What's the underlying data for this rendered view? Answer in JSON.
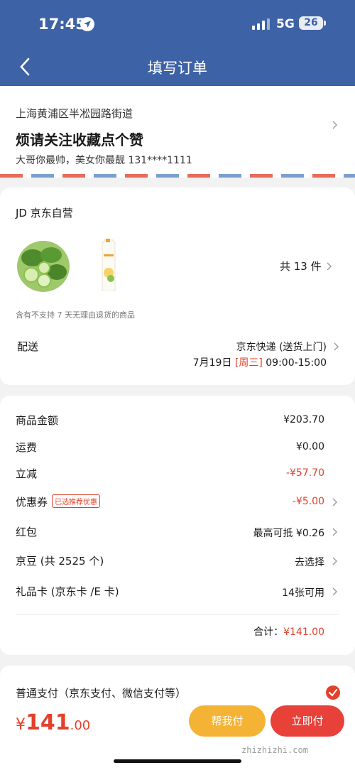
{
  "status": {
    "time": "17:45",
    "network": "5G",
    "battery": "26"
  },
  "header": {
    "title": "填写订单"
  },
  "address": {
    "line": "上海黄浦区半凇园路街道",
    "title": "烦请关注收藏点个赞",
    "contact": "大哥你最帅，美女你最靓  131****1111"
  },
  "shop": {
    "name": "JD 京东自营",
    "count": "共 13 件",
    "note": "含有不支持 7 天无理由退货的商品"
  },
  "shipping": {
    "label": "配送",
    "method": "京东快递 (送货上门)",
    "date": "7月19日",
    "weekday": "[周三]",
    "window": "09:00-15:00"
  },
  "summary": {
    "goods_label": "商品金额",
    "goods_value": "¥203.70",
    "freight_label": "运费",
    "freight_value": "¥0.00",
    "discount_label": "立减",
    "discount_value": "-¥57.70",
    "coupon_label": "优惠券",
    "coupon_tag": "已选推荐优惠",
    "coupon_value": "-¥5.00",
    "redpack_label": "红包",
    "redpack_value": "最高可抵 ¥0.26",
    "beans_label": "京豆 (共 2525 个)",
    "beans_value": "去选择",
    "giftcard_label": "礼品卡 (京东卡 /E 卡)",
    "giftcard_value": "14张可用",
    "total_label": "合计：",
    "total_value": "¥141.00"
  },
  "payment": {
    "method": "普通支付（京东支付、微信支付等）",
    "price_symbol": "¥",
    "price_int": "141",
    "price_dec": ".00",
    "help_label": "帮我付",
    "pay_label": "立即付",
    "watermark": "zhizhizhi.com"
  },
  "colors": {
    "header": "#3d62a6",
    "accent": "#e2412b",
    "help": "#f5b335"
  }
}
